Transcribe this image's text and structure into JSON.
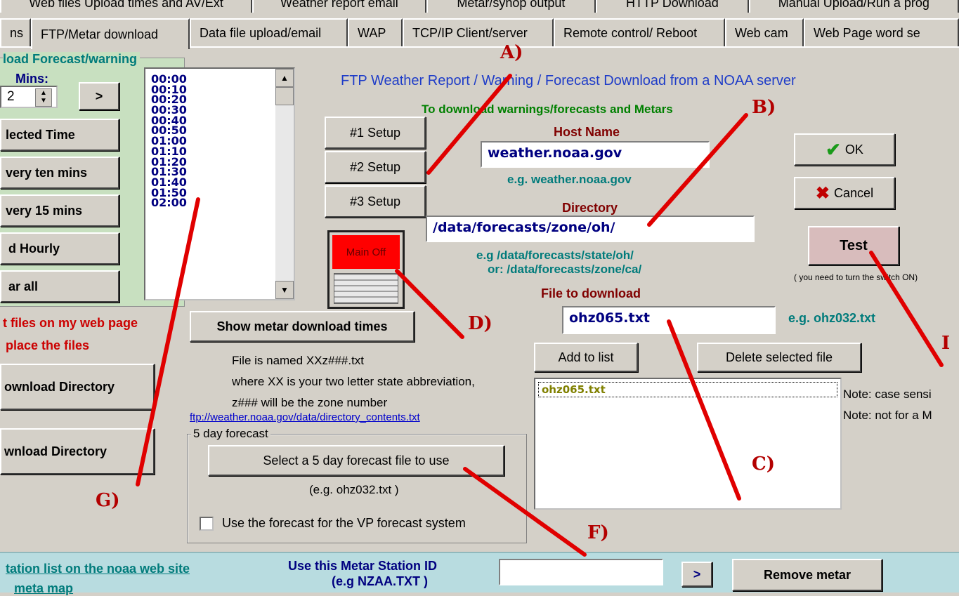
{
  "tabs_top": [
    "Web files Upload times and AV/Ext",
    "Weather report email",
    "Metar/synop output",
    "HTTP Download",
    "Manual Upload/Run a prog"
  ],
  "tabs_second": [
    "ns",
    "FTP/Metar download",
    "Data file upload/email",
    "WAP",
    "TCP/IP Client/server",
    "Remote control/ Reboot",
    "Web cam",
    "Web Page word se"
  ],
  "left_group": {
    "title": "load Forecast/warning",
    "mins_label": "Mins:",
    "mins_value": "2",
    "next_glyph": ">",
    "buttons": [
      "lected Time",
      "very ten mins",
      "very 15 mins",
      "d Hourly",
      "ar all"
    ],
    "times": [
      "00:00",
      "00:10",
      "00:20",
      "00:30",
      "00:40",
      "00:50",
      "01:00",
      "01:10",
      "01:20",
      "01:30",
      "01:40",
      "01:50",
      "02:00"
    ]
  },
  "left_red_lines": [
    "t files on my web page",
    "place the files"
  ],
  "left_buttons": [
    "ownload Directory",
    "wnload  Directory"
  ],
  "center": {
    "title": "FTP Weather Report / Warning / Forecast Download from a NOAA server",
    "subtitle": "To download warnings/forecasts and Metars",
    "setup_buttons": [
      "#1 Setup",
      "#2 Setup",
      "#3 Setup"
    ],
    "switch_label": "Main Off",
    "host_label": "Host Name",
    "host_value": "weather.noaa.gov",
    "host_example": "e.g. weather.noaa.gov",
    "dir_label": "Directory",
    "dir_value": "/data/forecasts/zone/oh/",
    "dir_example1": "e.g /data/forecasts/state/oh/",
    "dir_example2": "or: /data/forecasts/zone/ca/",
    "file_label": "File to download",
    "file_value": "ohz065.txt",
    "file_example": "e.g. ohz032.txt",
    "show_metar": "Show metar download times",
    "naming1": "File is named XXz###.txt",
    "naming2": "where XX is your two letter state abbreviation,",
    "naming3": "z### will be the zone number",
    "link": "ftp://weather.noaa.gov/data/directory_contents.txt",
    "add_to_list": "Add to list",
    "delete_file": "Delete selected file",
    "list_items": [
      "ohz065.txt"
    ],
    "note1": "Note: case sensi",
    "note2": "Note: not for a M"
  },
  "five_day": {
    "legend": "5 day forecast",
    "select_button": "Select a 5 day forecast file to use",
    "example": "(e.g. ohz032.txt )",
    "checkbox_label": "Use the forecast for the VP forecast system"
  },
  "right": {
    "ok": "OK",
    "cancel": "Cancel",
    "test": "Test",
    "test_note": "( you need to turn the switch ON)"
  },
  "bottom": {
    "station_link": "tation list on the noaa web site",
    "meta_map": "meta map",
    "metar_label1": "Use this Metar Station ID",
    "metar_label2": "(e.g NZAA.TXT )",
    "metar_value": "",
    "next_glyph": ">",
    "remove": "Remove metar"
  },
  "annotations": [
    "A)",
    "B)",
    "C)",
    "D)",
    "F)",
    "G)",
    "I"
  ],
  "colors": {
    "annotation_red": "#e00000",
    "switch_red": "#ff0000",
    "teal": "#007b7b",
    "dark_red_label": "#800000",
    "green_label": "#008000",
    "link_blue": "#0000cc"
  }
}
